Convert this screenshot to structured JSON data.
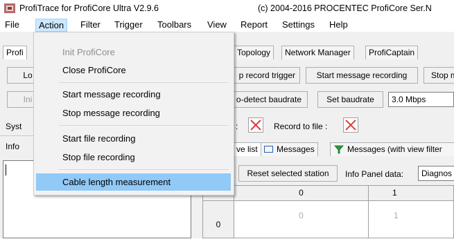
{
  "window": {
    "title": "ProfiTrace for ProfiCore Ultra V2.9.6",
    "title_right": "(c) 2004-2016 PROCENTEC  ProfiCore Ser.N"
  },
  "menubar": {
    "items": [
      "File",
      "Action",
      "Filter",
      "Trigger",
      "Toolbars",
      "View",
      "Report",
      "Settings",
      "Help"
    ],
    "active": "Action"
  },
  "action_menu": {
    "items": [
      {
        "label": "Init ProfiCore",
        "enabled": false
      },
      {
        "label": "Close ProfiCore",
        "enabled": true
      },
      {
        "label": "Start message recording",
        "enabled": true
      },
      {
        "label": "Stop message recording",
        "enabled": true
      },
      {
        "label": "Start file recording",
        "enabled": true
      },
      {
        "label": "Stop file recording",
        "enabled": true
      },
      {
        "label": "Cable length measurement",
        "enabled": true,
        "highlighted": true
      }
    ]
  },
  "background": {
    "main_tab_partial": "Profi",
    "tabs": [
      "Topology",
      "Network Manager",
      "ProfiCaptain"
    ],
    "row1_left_partial": "Lo",
    "row1_buttons": [
      "p record trigger",
      "Start message recording",
      "Stop m"
    ],
    "row2_left_partial": "Ini",
    "row2_buttons": [
      "o-detect baudrate",
      "Set baudrate"
    ],
    "baudrate_value": "3.0 Mbps",
    "row3_left_partial": "Syst",
    "record_label_partial": ":",
    "record_to_file_label": "Record to file :",
    "info_label": "Info",
    "sub_tabs": [
      "ve list",
      "Messages",
      "Messages (with view filter"
    ],
    "reset_button": "Reset selected station",
    "info_panel_label": "Info Panel data:",
    "info_panel_value": "Diagnos",
    "grid_columns": [
      "0",
      "1"
    ],
    "grid_rows": [
      {
        "header": "0",
        "values": [
          "0",
          "1"
        ]
      }
    ]
  },
  "colors": {
    "menu_hover": "#91c9f7",
    "menu_active_bg": "#cce8ff",
    "x_mark": "#e03c3c",
    "disabled_text": "#8d8d8d"
  }
}
